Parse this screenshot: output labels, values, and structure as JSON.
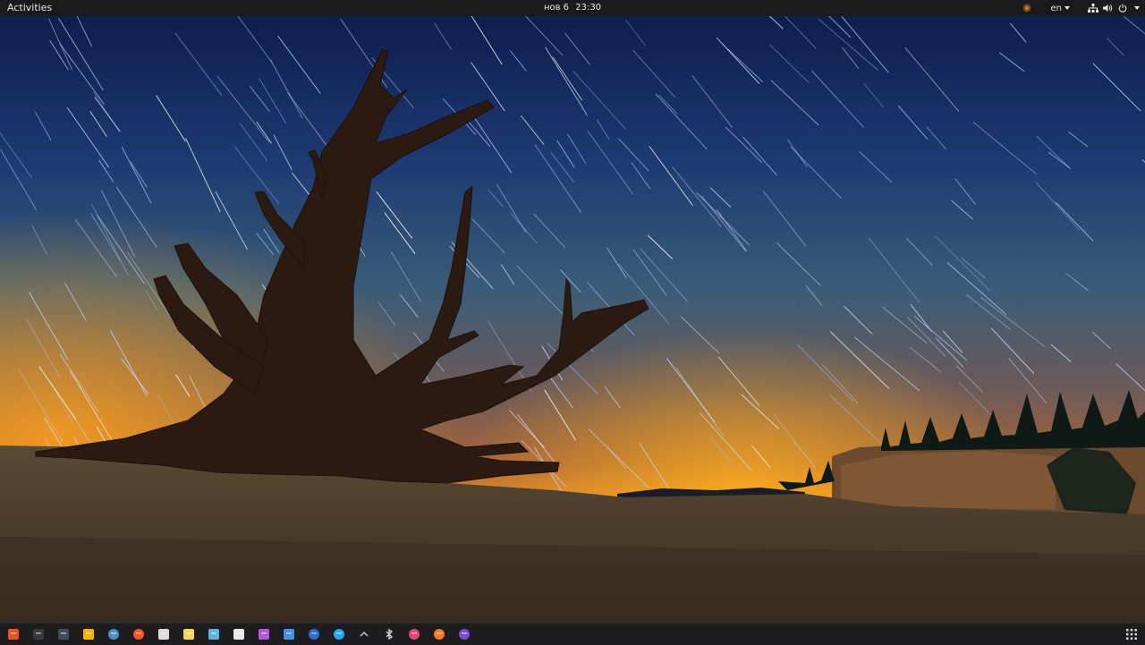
{
  "desktop": {
    "wallpaper": "star-trails-bristlecone-pine-night-sky"
  },
  "topbar": {
    "activities_label": "Activities",
    "date": "нов 6",
    "time": "23:30",
    "keyboard_layout": "en",
    "tray_icons": [
      "screen-recorder-icon",
      "network-icon",
      "volume-icon",
      "power-icon"
    ]
  },
  "dock": {
    "apps": [
      {
        "name": "software-center-icon",
        "color": "#e95420"
      },
      {
        "name": "terminal-icon",
        "color": "#3a3a3a"
      },
      {
        "name": "terminal-alt-icon",
        "color": "#444a5a"
      },
      {
        "name": "text-editor-icon",
        "color": "#f4b400"
      },
      {
        "name": "clock-icon",
        "color": "#4a90c2"
      },
      {
        "name": "brave-browser-icon",
        "color": "#fb542b"
      },
      {
        "name": "files-icon",
        "color": "#dcdcdc"
      },
      {
        "name": "notes-icon",
        "color": "#f6d656"
      },
      {
        "name": "settings-tool-icon",
        "color": "#5fb3d9"
      },
      {
        "name": "task-list-icon",
        "color": "#e8e8e8"
      },
      {
        "name": "video-editor-icon",
        "color": "#b25ad6"
      },
      {
        "name": "document-icon",
        "color": "#4a8fe7"
      },
      {
        "name": "vpn-icon",
        "color": "#2e6bd9"
      },
      {
        "name": "vscode-icon",
        "color": "#23a9f2"
      },
      {
        "name": "tray-chevron-icon",
        "color": "#cccccc"
      },
      {
        "name": "bluetooth-icon",
        "color": "#cccccc"
      },
      {
        "name": "color-picker-icon",
        "color": "#e04a7a"
      },
      {
        "name": "blender-icon",
        "color": "#f5792a"
      },
      {
        "name": "visual-studio-icon",
        "color": "#7b4bd1"
      }
    ],
    "show_apps_icon": "app-grid-icon"
  }
}
